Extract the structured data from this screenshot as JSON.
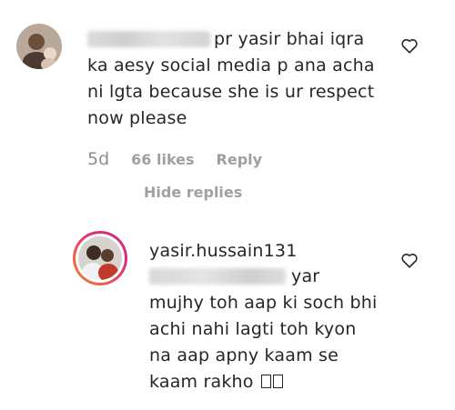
{
  "comment": {
    "text": "pr yasir bhai iqra ka aesy social media p ana acha ni lgta because she is ur respect now please",
    "line1": "pr yasir bhai iqra",
    "line2": "ka aesy social media p ana acha",
    "line3": "ni lgta because she is ur respect",
    "line4": "now please",
    "time": "5d",
    "likes": "66 likes",
    "reply_label": "Reply",
    "hide_replies_label": "Hide replies"
  },
  "reply": {
    "username": "yasir.hussain131",
    "line1": "yar",
    "line2": "mujhy toh aap ki soch bhi",
    "line3": "achi nahi lagti toh kyon",
    "line4": "na aap apny kaam se",
    "line5": "kaam rakho",
    "emoji_count": 2
  },
  "icons": {
    "like": "heart-outline-icon",
    "reply_avatar_ring": "story-ring-gradient"
  },
  "colors": {
    "text": "#262626",
    "muted": "#9a9a9a",
    "ring_start": "#f58529",
    "ring_end": "#dd2a7b"
  }
}
